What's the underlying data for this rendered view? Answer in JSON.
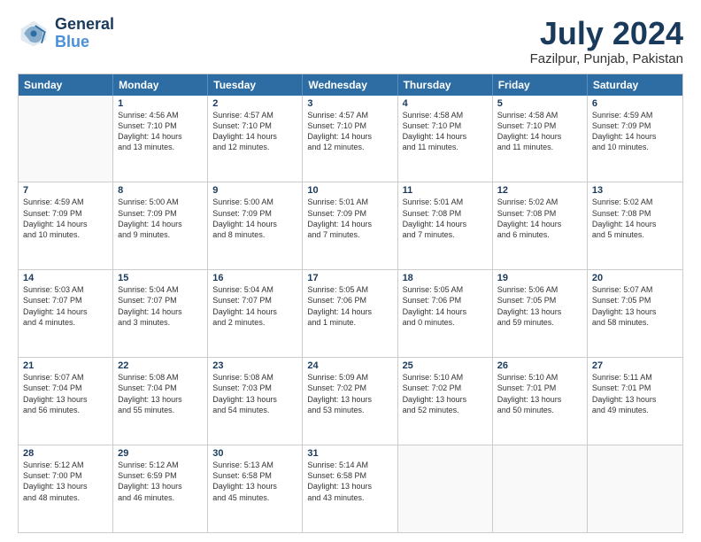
{
  "logo": {
    "line1": "General",
    "line2": "Blue"
  },
  "title": "July 2024",
  "subtitle": "Fazilpur, Punjab, Pakistan",
  "header_days": [
    "Sunday",
    "Monday",
    "Tuesday",
    "Wednesday",
    "Thursday",
    "Friday",
    "Saturday"
  ],
  "weeks": [
    [
      {
        "day": "",
        "text": ""
      },
      {
        "day": "1",
        "text": "Sunrise: 4:56 AM\nSunset: 7:10 PM\nDaylight: 14 hours\nand 13 minutes."
      },
      {
        "day": "2",
        "text": "Sunrise: 4:57 AM\nSunset: 7:10 PM\nDaylight: 14 hours\nand 12 minutes."
      },
      {
        "day": "3",
        "text": "Sunrise: 4:57 AM\nSunset: 7:10 PM\nDaylight: 14 hours\nand 12 minutes."
      },
      {
        "day": "4",
        "text": "Sunrise: 4:58 AM\nSunset: 7:10 PM\nDaylight: 14 hours\nand 11 minutes."
      },
      {
        "day": "5",
        "text": "Sunrise: 4:58 AM\nSunset: 7:10 PM\nDaylight: 14 hours\nand 11 minutes."
      },
      {
        "day": "6",
        "text": "Sunrise: 4:59 AM\nSunset: 7:09 PM\nDaylight: 14 hours\nand 10 minutes."
      }
    ],
    [
      {
        "day": "7",
        "text": "Sunrise: 4:59 AM\nSunset: 7:09 PM\nDaylight: 14 hours\nand 10 minutes."
      },
      {
        "day": "8",
        "text": "Sunrise: 5:00 AM\nSunset: 7:09 PM\nDaylight: 14 hours\nand 9 minutes."
      },
      {
        "day": "9",
        "text": "Sunrise: 5:00 AM\nSunset: 7:09 PM\nDaylight: 14 hours\nand 8 minutes."
      },
      {
        "day": "10",
        "text": "Sunrise: 5:01 AM\nSunset: 7:09 PM\nDaylight: 14 hours\nand 7 minutes."
      },
      {
        "day": "11",
        "text": "Sunrise: 5:01 AM\nSunset: 7:08 PM\nDaylight: 14 hours\nand 7 minutes."
      },
      {
        "day": "12",
        "text": "Sunrise: 5:02 AM\nSunset: 7:08 PM\nDaylight: 14 hours\nand 6 minutes."
      },
      {
        "day": "13",
        "text": "Sunrise: 5:02 AM\nSunset: 7:08 PM\nDaylight: 14 hours\nand 5 minutes."
      }
    ],
    [
      {
        "day": "14",
        "text": "Sunrise: 5:03 AM\nSunset: 7:07 PM\nDaylight: 14 hours\nand 4 minutes."
      },
      {
        "day": "15",
        "text": "Sunrise: 5:04 AM\nSunset: 7:07 PM\nDaylight: 14 hours\nand 3 minutes."
      },
      {
        "day": "16",
        "text": "Sunrise: 5:04 AM\nSunset: 7:07 PM\nDaylight: 14 hours\nand 2 minutes."
      },
      {
        "day": "17",
        "text": "Sunrise: 5:05 AM\nSunset: 7:06 PM\nDaylight: 14 hours\nand 1 minute."
      },
      {
        "day": "18",
        "text": "Sunrise: 5:05 AM\nSunset: 7:06 PM\nDaylight: 14 hours\nand 0 minutes."
      },
      {
        "day": "19",
        "text": "Sunrise: 5:06 AM\nSunset: 7:05 PM\nDaylight: 13 hours\nand 59 minutes."
      },
      {
        "day": "20",
        "text": "Sunrise: 5:07 AM\nSunset: 7:05 PM\nDaylight: 13 hours\nand 58 minutes."
      }
    ],
    [
      {
        "day": "21",
        "text": "Sunrise: 5:07 AM\nSunset: 7:04 PM\nDaylight: 13 hours\nand 56 minutes."
      },
      {
        "day": "22",
        "text": "Sunrise: 5:08 AM\nSunset: 7:04 PM\nDaylight: 13 hours\nand 55 minutes."
      },
      {
        "day": "23",
        "text": "Sunrise: 5:08 AM\nSunset: 7:03 PM\nDaylight: 13 hours\nand 54 minutes."
      },
      {
        "day": "24",
        "text": "Sunrise: 5:09 AM\nSunset: 7:02 PM\nDaylight: 13 hours\nand 53 minutes."
      },
      {
        "day": "25",
        "text": "Sunrise: 5:10 AM\nSunset: 7:02 PM\nDaylight: 13 hours\nand 52 minutes."
      },
      {
        "day": "26",
        "text": "Sunrise: 5:10 AM\nSunset: 7:01 PM\nDaylight: 13 hours\nand 50 minutes."
      },
      {
        "day": "27",
        "text": "Sunrise: 5:11 AM\nSunset: 7:01 PM\nDaylight: 13 hours\nand 49 minutes."
      }
    ],
    [
      {
        "day": "28",
        "text": "Sunrise: 5:12 AM\nSunset: 7:00 PM\nDaylight: 13 hours\nand 48 minutes."
      },
      {
        "day": "29",
        "text": "Sunrise: 5:12 AM\nSunset: 6:59 PM\nDaylight: 13 hours\nand 46 minutes."
      },
      {
        "day": "30",
        "text": "Sunrise: 5:13 AM\nSunset: 6:58 PM\nDaylight: 13 hours\nand 45 minutes."
      },
      {
        "day": "31",
        "text": "Sunrise: 5:14 AM\nSunset: 6:58 PM\nDaylight: 13 hours\nand 43 minutes."
      },
      {
        "day": "",
        "text": ""
      },
      {
        "day": "",
        "text": ""
      },
      {
        "day": "",
        "text": ""
      }
    ]
  ]
}
